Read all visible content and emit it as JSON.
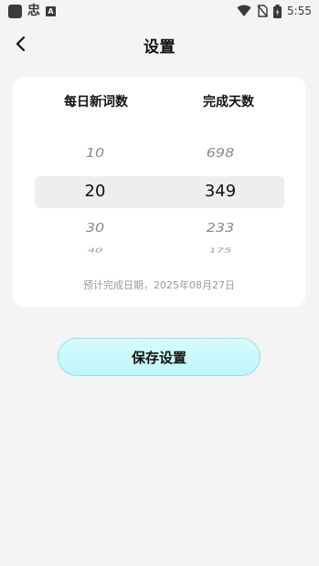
{
  "status_bar": {
    "time": "5:55",
    "app_glyph": "忠",
    "badge_letter": "A",
    "icons": [
      "app-square-icon",
      "wifi-icon",
      "no-sim-icon",
      "battery-icon"
    ]
  },
  "header": {
    "title": "设置",
    "back_icon": "chevron-left-icon"
  },
  "picker": {
    "daily_words": {
      "label": "每日新词数",
      "options": [
        "10",
        "20",
        "30",
        "40"
      ],
      "selected": "20"
    },
    "days_to_complete": {
      "label": "完成天数",
      "options": [
        "698",
        "349",
        "233",
        "175"
      ],
      "selected": "349"
    }
  },
  "estimate_text": "预计完成日期，2025年08月27日",
  "save_label": "保存设置",
  "colors": {
    "background": "#f4f4f4",
    "card": "#ffffff",
    "button_fill": "#c8f8fa",
    "button_border": "#8fe3e8"
  }
}
